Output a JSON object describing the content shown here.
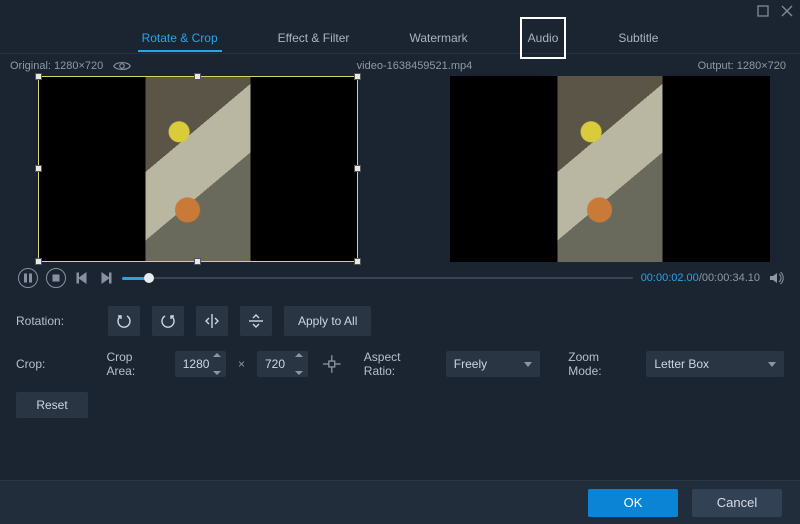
{
  "window": {
    "maximize_title": "Maximize",
    "close_title": "Close"
  },
  "tabs": {
    "rotate_crop": "Rotate & Crop",
    "effect_filter": "Effect & Filter",
    "watermark": "Watermark",
    "audio": "Audio",
    "subtitle": "Subtitle",
    "active": "rotate_crop",
    "highlighted": "audio"
  },
  "info": {
    "original_label": "Original: 1280×720",
    "filename": "video-1638459521.mp4",
    "output_label": "Output: 1280×720"
  },
  "player": {
    "current_time": "00:00:02.00",
    "duration": "00:00:34.10",
    "separator": "/"
  },
  "rotation": {
    "label": "Rotation:",
    "apply_all": "Apply to All"
  },
  "crop": {
    "label": "Crop:",
    "area_label": "Crop Area:",
    "width": "1280",
    "height": "720",
    "multiply": "×",
    "aspect_label": "Aspect Ratio:",
    "aspect_value": "Freely",
    "zoom_label": "Zoom Mode:",
    "zoom_value": "Letter Box"
  },
  "reset": {
    "label": "Reset"
  },
  "footer": {
    "ok": "OK",
    "cancel": "Cancel"
  },
  "colors": {
    "accent": "#2aa3e8",
    "panel": "#2a3544",
    "bg": "#1b2532"
  }
}
